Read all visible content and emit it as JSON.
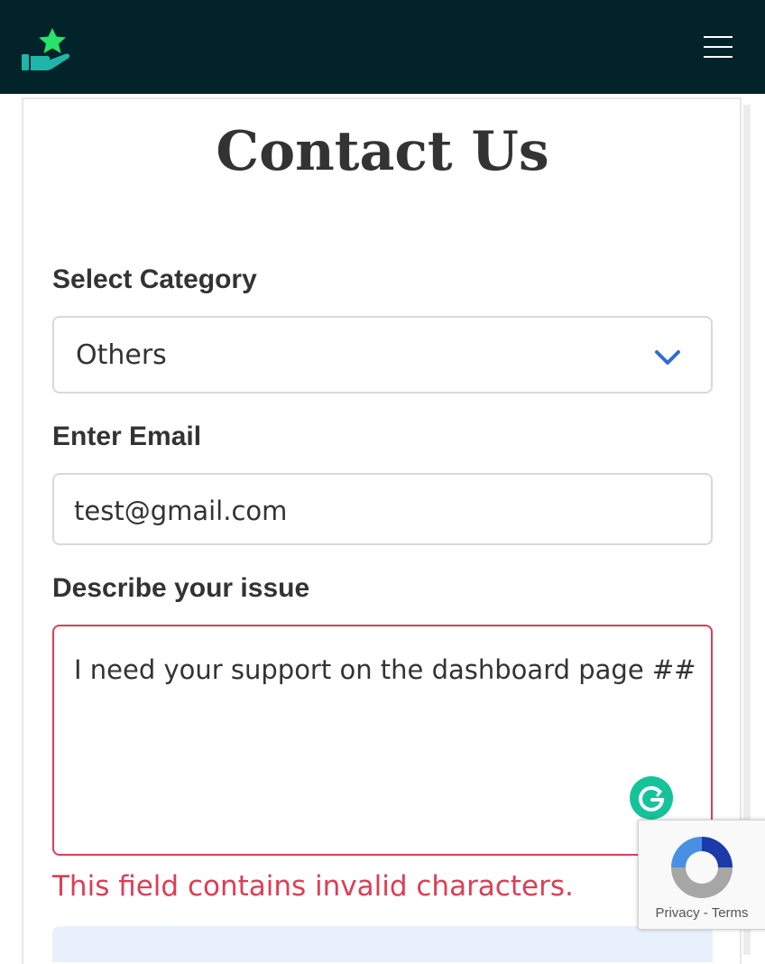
{
  "navbar": {
    "logo_icon": "star-hand-icon",
    "menu_icon": "hamburger-menu-icon",
    "background_color": "#03232a"
  },
  "page": {
    "title": "Contact Us"
  },
  "form": {
    "category": {
      "label": "Select Category",
      "selected": "Others",
      "icon": "chevron-down-icon"
    },
    "email": {
      "label": "Enter Email",
      "value": "test@gmail.com"
    },
    "issue": {
      "label": "Describe your issue",
      "value": "I need your support on the dashboard page ##",
      "error": "This field contains invalid characters.",
      "error_color": "#dc3e55"
    }
  },
  "recaptcha": {
    "privacy": "Privacy",
    "separator": " - ",
    "terms": "Terms"
  },
  "grammarly": {
    "icon": "grammarly-icon",
    "color": "#15c39a"
  }
}
